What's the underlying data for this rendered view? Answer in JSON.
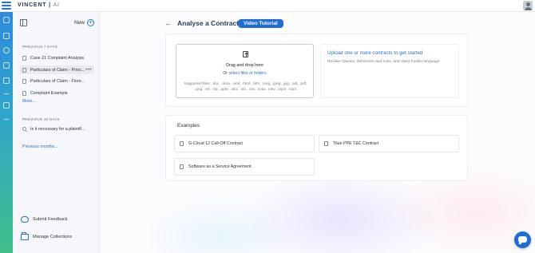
{
  "app": {
    "brand": "VINCENT",
    "brand_suffix": "AI"
  },
  "sidebar": {
    "new_label": "New",
    "section_recent": "PREVIOUS 7 DAYS",
    "recent_items": [
      {
        "label": "Case 21 Complaint Analysis"
      },
      {
        "label": "Particulars of Claim - Princ..."
      },
      {
        "label": "Particulars of Claim - Flore..."
      },
      {
        "label": "Complaint Example"
      }
    ],
    "more_label": "More...",
    "section_older": "PREVIOUS 30 DAYS",
    "older_items": [
      {
        "label": "Is it necessary for a plaintif..."
      }
    ],
    "previous_months_label": "Previous months...",
    "submit_feedback": "Submit Feedback",
    "manage_collections": "Manage Collections"
  },
  "main": {
    "title": "Analyse a Contract",
    "tutorial_button": "Video Tutorial",
    "upload": {
      "title": "Drag and drop here",
      "or": "Or",
      "select_link": "select files or folders",
      "supported": "Supported files: .doc, .docx, .eml, .html, .htm, .msg, .jpeg, .jpg, .odt, .pdf, .png, .txt, .zip, .pptx, .xlsx, .xls, .csv, .m4a, .mkv, .mp3, .mp4"
    },
    "info": {
      "title": "Upload one or more contracts to get started",
      "subtitle": "Review clauses, definitions and risks, and client-hostile language"
    },
    "examples_label": "Examples",
    "examples": [
      {
        "label": "G-Cloud 12 Call-Off Contract"
      },
      {
        "label": "Titan PPE T&C Contract"
      },
      {
        "label": "Software as a Service Agreement"
      }
    ]
  },
  "colors": {
    "accent": "#1f6bd8",
    "rail_top": "#2d8be0",
    "rail_bottom": "#3fbf8a"
  }
}
